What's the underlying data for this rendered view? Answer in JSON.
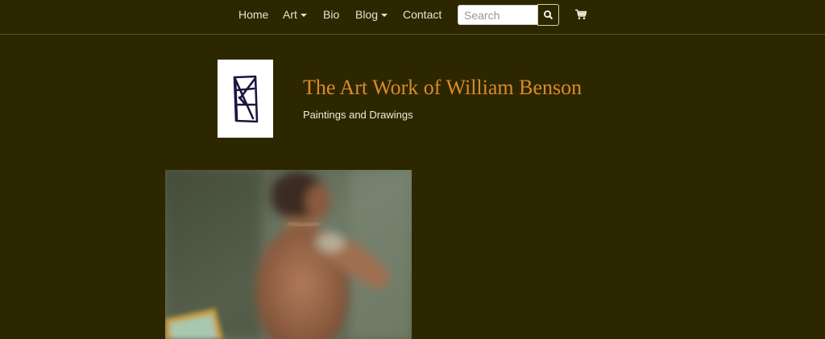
{
  "nav": {
    "items": [
      {
        "label": "Home",
        "dropdown": false
      },
      {
        "label": "Art",
        "dropdown": true
      },
      {
        "label": "Bio",
        "dropdown": false
      },
      {
        "label": "Blog",
        "dropdown": true
      },
      {
        "label": "Contact",
        "dropdown": false
      }
    ],
    "search": {
      "placeholder": "Search",
      "value": "",
      "button_icon": "search-icon"
    },
    "cart_icon": "shopping-cart-icon"
  },
  "header": {
    "logo": "signature-logo",
    "title": "The Art Work of William Benson",
    "subtitle": "Paintings and Drawings"
  },
  "main": {
    "featured_image": "painting-figure-image"
  },
  "colors": {
    "background": "#2d2700",
    "title": "#d98b2a",
    "nav_text": "#e8e4d0",
    "divider": "#5a5233"
  }
}
